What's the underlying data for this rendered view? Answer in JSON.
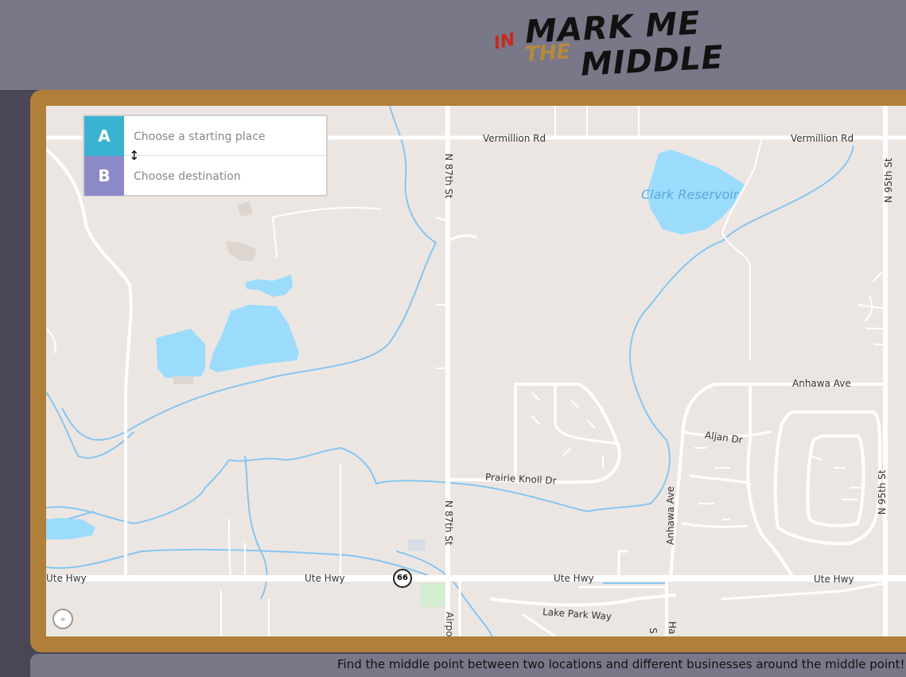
{
  "logo": {
    "word_in": "IN",
    "word_mark_me": "MARK ME",
    "word_the": "THE",
    "word_middle": "MIDDLE"
  },
  "directions": {
    "start_badge": "A",
    "start_placeholder": "Choose a starting place",
    "end_badge": "B",
    "end_placeholder": "Choose destination",
    "swap_icon": "swap-vertical-icon"
  },
  "map": {
    "labels": {
      "vermillion_rd_left": "Vermillion Rd",
      "vermillion_rd_right": "Vermillion Rd",
      "clark_reservoir": "Clark Reservoir",
      "n87th_st_top": "N 87th St",
      "n87th_st_bottom": "N 87th St",
      "n95th_st_top": "N 95th St",
      "n95th_st_bottom": "N 95th St",
      "anhawa_ave": "Anhawa Ave",
      "anhawa_ave_vertical": "Anhawa Ave",
      "aljan_dr": "Aljan Dr",
      "prairie_knoll_dr": "Prairie Knoll Dr",
      "ute_hwy_1": "Ute Hwy",
      "ute_hwy_2": "Ute Hwy",
      "ute_hwy_3": "Ute Hwy",
      "ute_hwy_4": "Ute Hwy",
      "route_66": "66",
      "lake_park_way": "Lake Park Way",
      "airport_partial": "Airpo",
      "ha_partial": "Ha",
      "s_partial": "S",
      "rn_partial": "n"
    },
    "colors": {
      "land": "#ece6e3",
      "water": "#9bdcfc",
      "road": "#ffffff",
      "stream": "#86c6f0"
    },
    "compass_icon": "compass-icon"
  },
  "footer": {
    "text": "Find the middle point between two locations and different businesses around the middle point!"
  }
}
